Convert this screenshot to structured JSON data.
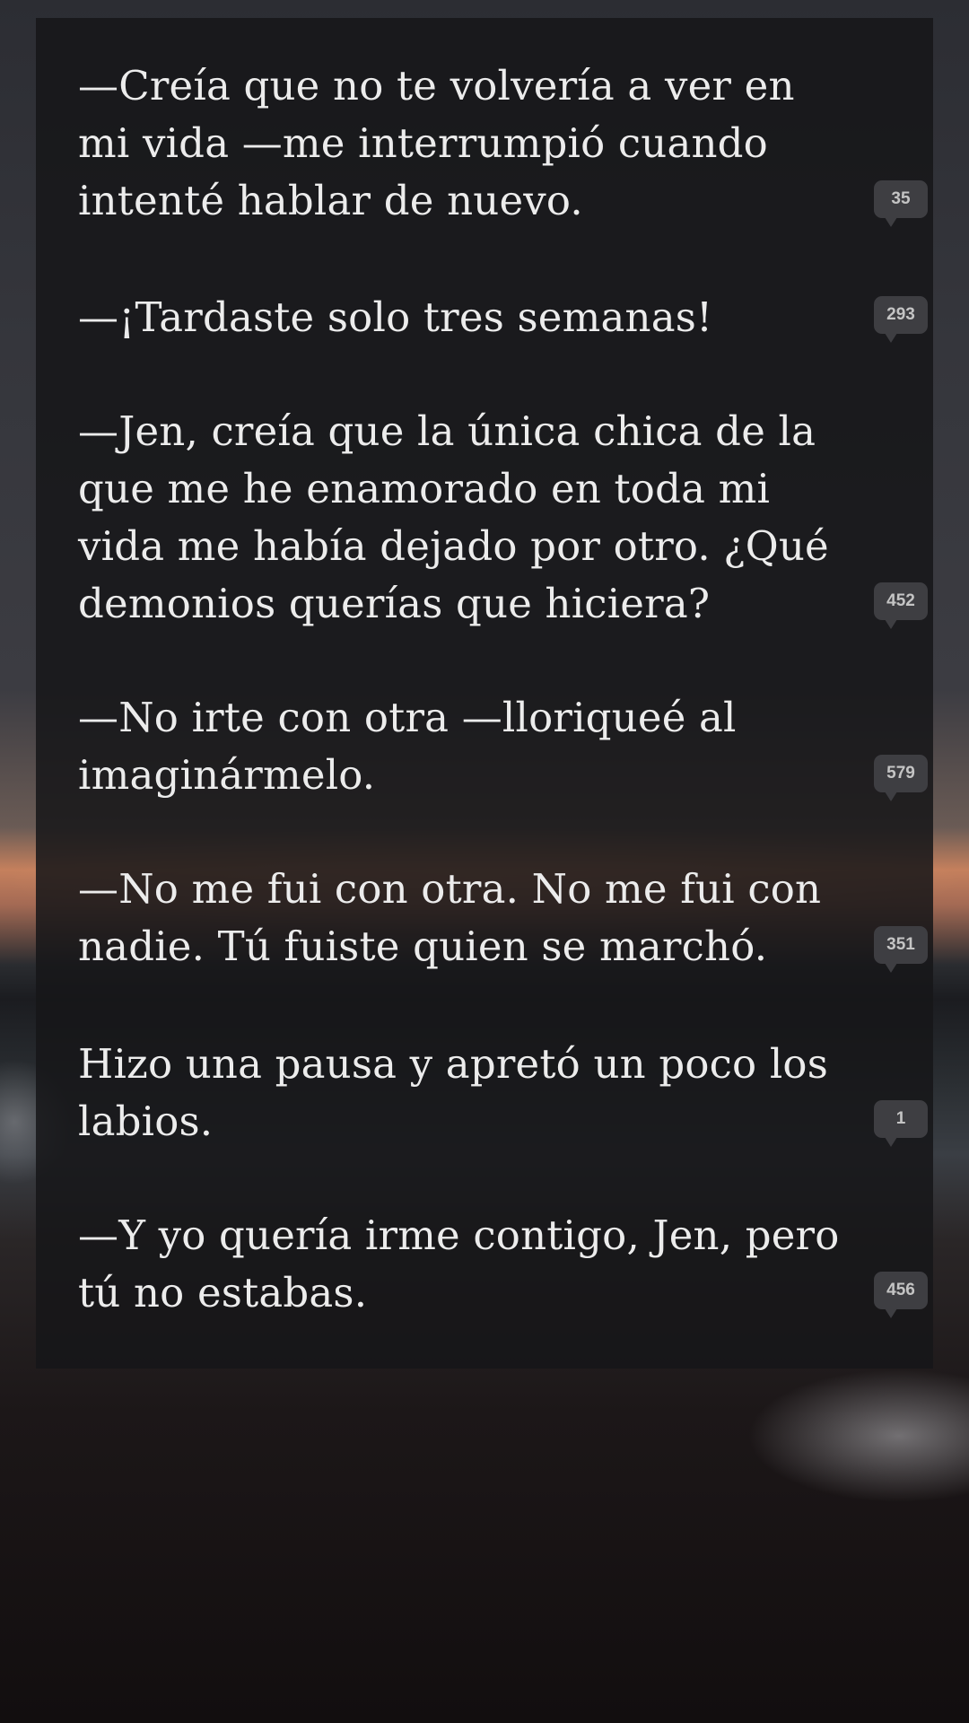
{
  "reader": {
    "paragraphs": [
      {
        "lines": [
          "—Creía que no te volvería a ver en",
          "mi vida —me interrumpió cuando",
          "intenté hablar de nuevo."
        ],
        "comment_count": "35"
      },
      {
        "lines": [
          "—¡Tardaste solo tres semanas!"
        ],
        "comment_count": "293"
      },
      {
        "lines": [
          "—Jen, creía que la única chica de la",
          "que me he enamorado en toda mi",
          "vida me había dejado por otro. ¿Qué",
          "demonios querías que hiciera?"
        ],
        "comment_count": "452"
      },
      {
        "lines": [
          "—No irte con otra —lloriqueé al",
          "imaginármelo."
        ],
        "comment_count": "579"
      },
      {
        "lines": [
          "—No me fui con otra. No me fui con",
          "nadie. Tú fuiste quien se marchó."
        ],
        "comment_count": "351"
      },
      {
        "lines": [
          "Hizo una pausa y apretó un poco los",
          "labios."
        ],
        "comment_count": "1"
      },
      {
        "lines": [
          "—Y yo quería irme contigo, Jen, pero",
          "tú no estabas."
        ],
        "comment_count": "456"
      }
    ]
  },
  "theme": {
    "text_color": "#ececec",
    "panel_color": "#161618",
    "bubble_color": "#3e3e42",
    "bubble_text_color": "#c4c4c4"
  },
  "icons": {
    "comment_bubble": "comment-bubble-icon"
  }
}
